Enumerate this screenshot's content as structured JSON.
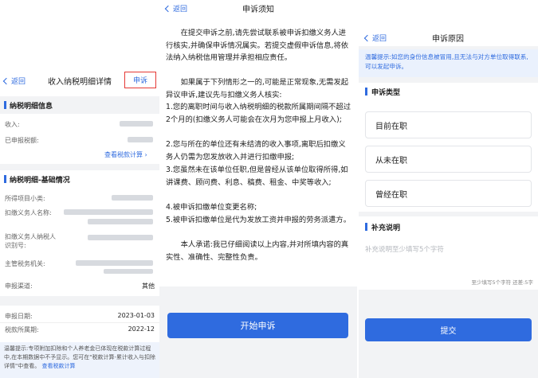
{
  "detail": {
    "back": "返回",
    "title": "收入纳税明细详情",
    "appeal": "申诉",
    "section_tax": "纳税明细信息",
    "income_label": "收入:",
    "paid_label": "已申报税额:",
    "view_calc": "查看税款计算",
    "section_basic": "纳税明细-基础情况",
    "item_label": "所得项目小类:",
    "withholder_name_label": "扣缴义务人名称:",
    "withholder_id_label": "扣缴义务人纳税人识别号:",
    "tax_authority_label": "主管税务机关:",
    "declare_type_label": "申报渠道:",
    "declare_type_value": "其他",
    "declare_date_label": "申报日期:",
    "declare_date_value": "2023-01-03",
    "tax_period_label": "税款所属期:",
    "tax_period_value": "2022-12",
    "tip": "温馨提示:专项附加扣除和个人养老金已体现在税款计算过程中,在本期数据中不予显示。您可在\"税款计算-累计收入与扣除详情\"中查看。",
    "tip_link": "查看税款计算"
  },
  "notice": {
    "back": "返回",
    "title": "申诉须知",
    "paragraphs": [
      "在提交申诉之前,请先尝试联系被申诉扣缴义务人进行核实,并确保申诉情况属实。若提交虚假申诉信息,将依法纳入纳税信用管理并承担相应责任。",
      "如果属于下列情形之一的,可能是正常现象,无需发起异议申诉,建议先与扣缴义务人核实:",
      "1.您的离职时间与收入纳税明细的税款所属期间隔不超过2个月的(扣缴义务人可能会在次月为您申报上月收入);",
      "2.您与所在的单位还有未结清的收入事项,离职后扣缴义务人仍需为您发放收入并进行扣缴申报;",
      "3.您虽然未在该单位任职,但是曾经从该单位取得所得,如讲课费、顾问费、利息、稿费、租金、中奖等收入;",
      "4.被申诉扣缴单位变更名称;",
      "5.被申诉扣缴单位是代为发放工资并申报的劳务派遣方。",
      "本人承诺:我已仔细阅读以上内容,并对所填内容的真实性、准确性、完整性负责。"
    ],
    "start_button": "开始申诉"
  },
  "reason": {
    "back": "返回",
    "title": "申诉原因",
    "tip": "温馨提示:如您的身份信息被冒用,且无法与对方单位取得联系,可以发起申诉。",
    "section_type": "申诉类型",
    "options": [
      "目前在职",
      "从未在职",
      "曾经在职"
    ],
    "section_extra": "补充说明",
    "placeholder": "补充说明至少填写5个字符",
    "counter": "至少填写5个字符 还差:5字",
    "submit": "提交"
  },
  "colors": {
    "accent": "#2f6bdf",
    "highlight": "#e53935",
    "page_bg": "#f2f3f5"
  }
}
